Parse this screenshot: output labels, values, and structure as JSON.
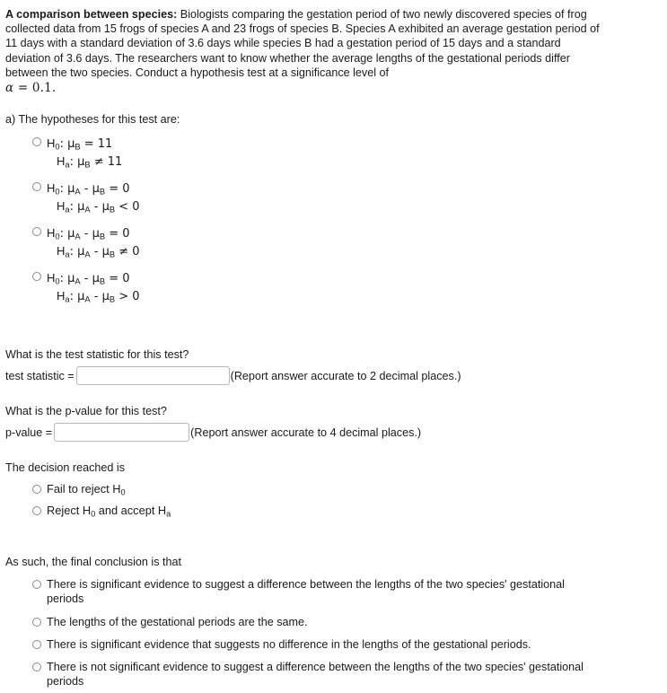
{
  "problem": {
    "lead_in": "A comparison between species:",
    "body": " Biologists comparing the gestation period of two newly discovered species of frog collected data from 15 frogs of species A and 23 frogs of species B. Species A exhibited an average gestation period of 11 days with a standard deviation of 3.6 days while species B had a gestation period of 15 days and a standard deviation of 3.6 days. The researchers want to know whether the average lengths of the gestational periods differ between the two species. Conduct a hypothesis test at a significance level of",
    "alpha_symbol": "α",
    "alpha_equals": "= 0.1.",
    "values": {
      "n_a": 15,
      "n_b": 23,
      "mean_a": 11,
      "sd_a": 3.6,
      "mean_b": 15,
      "sd_b": 3.6,
      "alpha": 0.1
    }
  },
  "part_a": {
    "prompt": "a) The hypotheses for this test are:",
    "options": [
      {
        "null_label": "H",
        "null_sub": "0",
        "null_body": ": μ",
        "null_sub2": "B",
        "null_rel": " = 11",
        "alt_label": "H",
        "alt_sub": "a",
        "alt_body": ": μ",
        "alt_sub2": "B",
        "alt_rel": " ≠ 11"
      },
      {
        "null_label": "H",
        "null_sub": "0",
        "null_body": ": μ",
        "null_sub2": "A",
        "null_mid": " - μ",
        "null_sub3": "B",
        "null_rel": " = 0",
        "alt_label": "H",
        "alt_sub": "a",
        "alt_body": ": μ",
        "alt_sub2": "A",
        "alt_mid": " - μ",
        "alt_sub3": "B",
        "alt_rel": " < 0"
      },
      {
        "null_label": "H",
        "null_sub": "0",
        "null_body": ": μ",
        "null_sub2": "A",
        "null_mid": " - μ",
        "null_sub3": "B",
        "null_rel": " = 0",
        "alt_label": "H",
        "alt_sub": "a",
        "alt_body": ": μ",
        "alt_sub2": "A",
        "alt_mid": " - μ",
        "alt_sub3": "B",
        "alt_rel": " ≠ 0"
      },
      {
        "null_label": "H",
        "null_sub": "0",
        "null_body": ": μ",
        "null_sub2": "A",
        "null_mid": " - μ",
        "null_sub3": "B",
        "null_rel": " = 0",
        "alt_label": "H",
        "alt_sub": "a",
        "alt_body": ": μ",
        "alt_sub2": "A",
        "alt_mid": " - μ",
        "alt_sub3": "B",
        "alt_rel": " > 0"
      }
    ]
  },
  "test_statistic": {
    "prompt": "What is the test statistic for this test?",
    "label": "test statistic =",
    "value": "",
    "placeholder": "",
    "note": "(Report answer accurate to 2 decimal places.)"
  },
  "p_value": {
    "prompt": "What is the p-value for this test?",
    "label": "p-value =",
    "value": "",
    "placeholder": "",
    "note": "(Report answer accurate to 4 decimal places.)"
  },
  "decision": {
    "prompt": "The decision reached is",
    "options": [
      {
        "pre": "Fail to reject H",
        "sub": "0",
        "post": ""
      },
      {
        "pre": "Reject H",
        "sub": "0",
        "post": " and accept H",
        "sub2": "a"
      }
    ]
  },
  "conclusion": {
    "prompt": "As such, the final conclusion is that",
    "options": [
      "There is significant evidence to suggest a difference between the lengths of the two species' gestational periods",
      "The lengths of the gestational periods are the same.",
      "There is significant evidence that suggests no difference in the lengths of the gestational periods.",
      "There is not significant evidence to suggest a difference between the lengths of the two species' gestational periods"
    ]
  },
  "colors": {
    "text": "#1a1a1a",
    "background": "#ffffff",
    "input_border": "#b8b8b8",
    "radio_border": "#8a8a8a"
  }
}
